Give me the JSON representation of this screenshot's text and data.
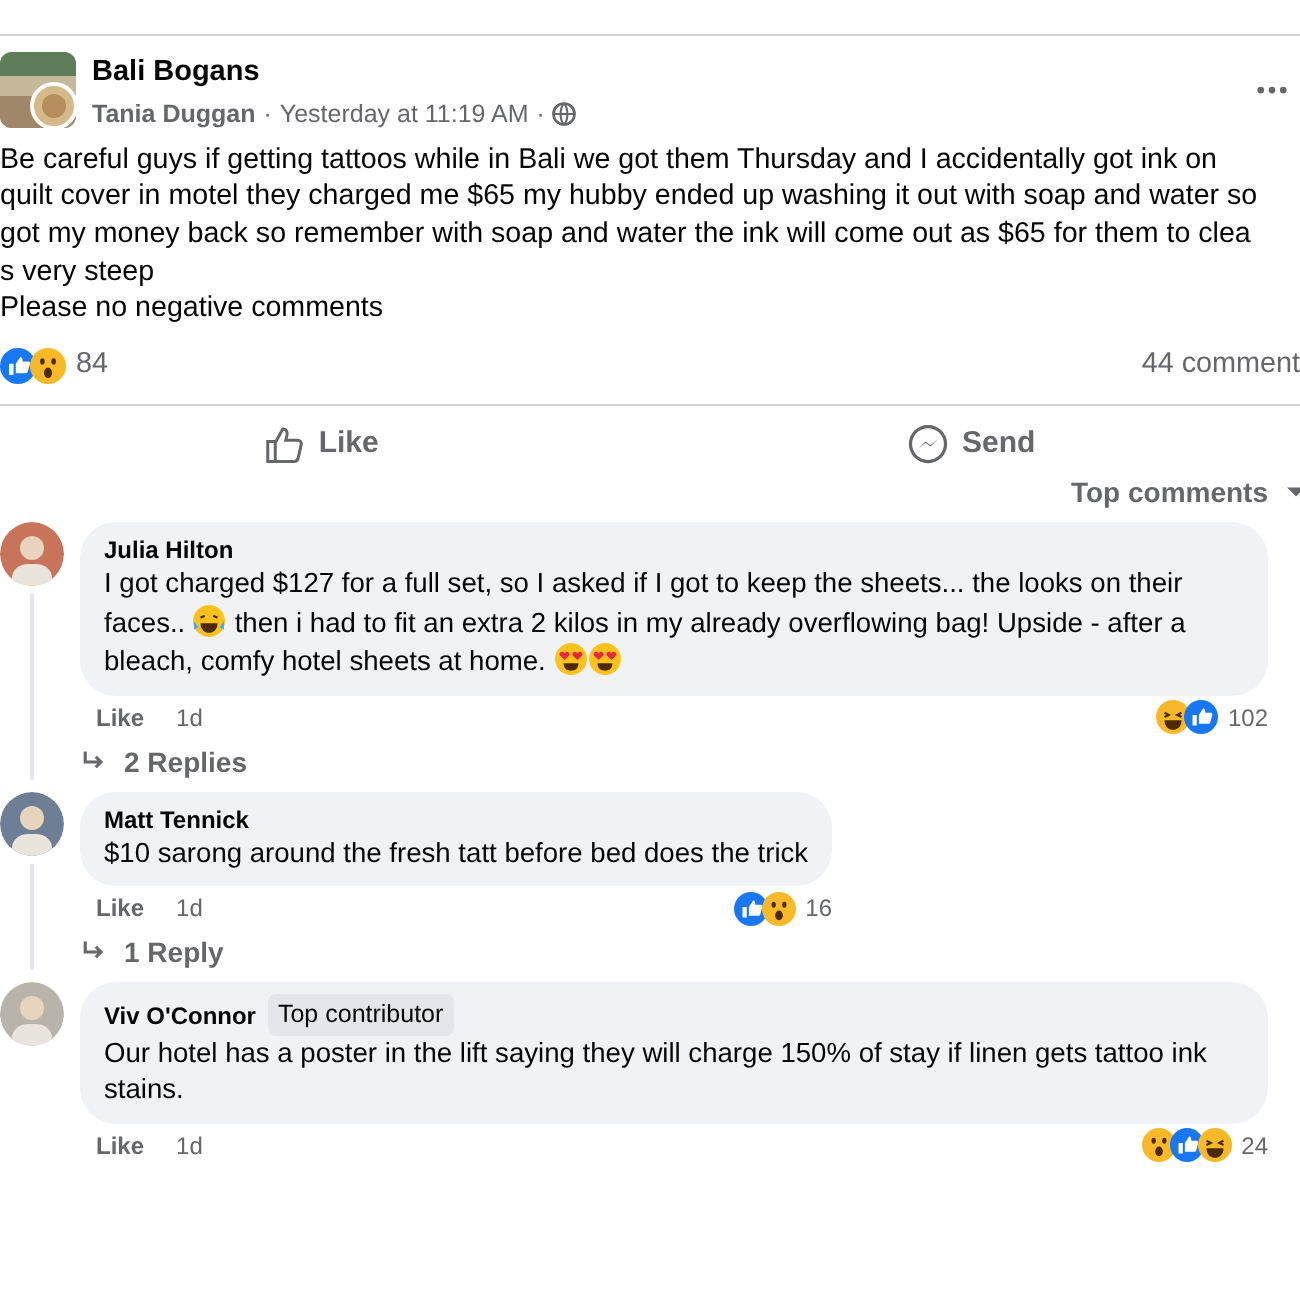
{
  "post": {
    "group": "Bali Bogans",
    "author": "Tania Duggan",
    "time": "Yesterday at 11:19 AM",
    "separator": "·",
    "lines": [
      "Be careful guys if getting tattoos while in Bali we got them Thursday and I accidentally got ink on",
      "quilt cover in motel they charged me $65 my hubby ended up washing it out with soap and water so",
      "got my money back so remember with soap and water the ink will come out as $65 for them to clea",
      "s very steep",
      "Please no negative comments"
    ],
    "reactions": [
      {
        "kind": "like"
      },
      {
        "kind": "wow"
      }
    ],
    "reaction_count": "84",
    "comments_count": "44 comment"
  },
  "actions": [
    {
      "kind": "like",
      "label": "Like"
    },
    {
      "kind": "send",
      "label": "Send"
    }
  ],
  "sort": "Top comments",
  "comments": [
    {
      "name": "Julia Hilton",
      "parts": [
        {
          "kind": "text",
          "text": "I got charged $127 for a full set, so I asked if I got to keep the sheets... the looks on their faces.. "
        },
        {
          "kind": "laugh"
        },
        {
          "kind": "text",
          "text": " then i had to fit an extra 2 kilos in my already overflowing bag! Upside - after a bleach, comfy hotel sheets at home. "
        },
        {
          "kind": "hearteyes"
        },
        {
          "kind": "hearteyes"
        }
      ],
      "like": "Like",
      "age": "1d",
      "reactions": [
        {
          "kind": "haha"
        },
        {
          "kind": "like"
        }
      ],
      "count": "102",
      "replies": "2 Replies"
    },
    {
      "name": "Matt Tennick",
      "parts": [
        {
          "kind": "text",
          "text": "$10 sarong around the fresh tatt before bed does the trick"
        }
      ],
      "like": "Like",
      "age": "1d",
      "reactions": [
        {
          "kind": "like"
        },
        {
          "kind": "wow"
        }
      ],
      "count": "16",
      "replies": "1 Reply"
    },
    {
      "name": "Viv O'Connor",
      "badge": "Top contributor",
      "parts": [
        {
          "kind": "text",
          "text": "Our hotel has a poster in the lift saying they will charge 150% of stay if linen gets tattoo ink stains."
        }
      ],
      "like": "Like",
      "age": "1d",
      "reactions": [
        {
          "kind": "wow"
        },
        {
          "kind": "like"
        },
        {
          "kind": "haha"
        }
      ],
      "count": "24"
    }
  ]
}
